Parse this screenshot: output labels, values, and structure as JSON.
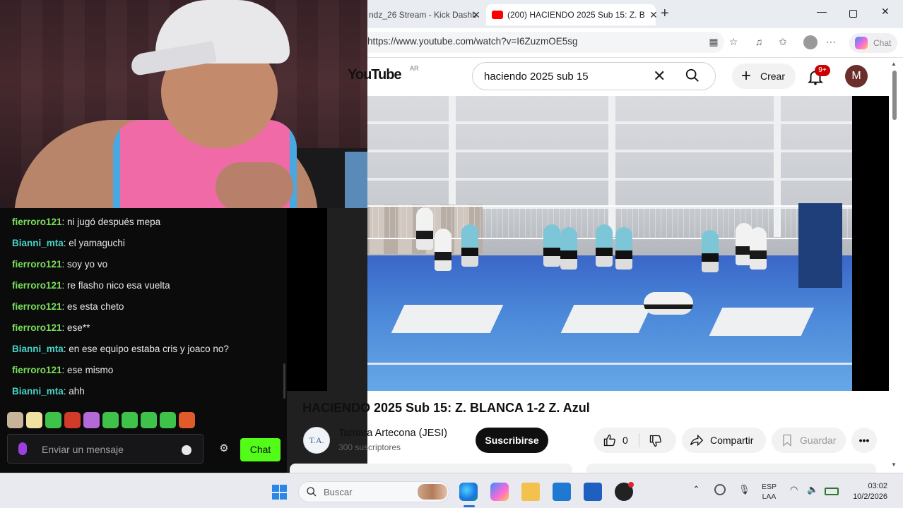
{
  "chat": {
    "messages": [
      {
        "user": "fierroro121",
        "text": ": ni jugó después mepa",
        "color": "#7be05a"
      },
      {
        "user": "Bianni_mta",
        "text": ": el yamaguchi",
        "color": "#47d4c8"
      },
      {
        "user": "fierroro121",
        "text": ": soy yo vo",
        "color": "#7be05a"
      },
      {
        "user": "fierroro121",
        "text": ": re flasho nico esa vuelta",
        "color": "#7be05a"
      },
      {
        "user": "fierroro121",
        "text": ": es esta cheto",
        "color": "#7be05a"
      },
      {
        "user": "fierroro121",
        "text": ": ese**",
        "color": "#7be05a"
      },
      {
        "user": "Bianni_mta",
        "text": ": en ese equipo estaba cris y joaco no?",
        "color": "#47d4c8"
      },
      {
        "user": "fierroro121",
        "text": ": ese mismo",
        "color": "#7be05a"
      },
      {
        "user": "Bianni_mta",
        "text": ": ahh",
        "color": "#47d4c8"
      }
    ],
    "input_placeholder": "Enviar un mensaje",
    "send_label": "Chat",
    "emotes": [
      "emote-1",
      "emote-2",
      "emote-3",
      "emote-4",
      "emote-5",
      "emote-6",
      "emote-7",
      "emote-8",
      "emote-9",
      "emote-10"
    ]
  },
  "browser": {
    "tabs": [
      {
        "title": "ndz_26 Stream - Kick Dashb"
      },
      {
        "title": "(200) HACIENDO 2025 Sub 15: Z. B"
      }
    ],
    "url": "https://www.youtube.com/watch?v=I6ZuzmOE5sg",
    "copilot_label": "Chat"
  },
  "youtube": {
    "logo": "YouTube",
    "country": "AR",
    "search_query": "haciendo 2025 sub 15",
    "create_label": "Crear",
    "notifications": "9+",
    "avatar_letter": "M",
    "video_title": "HACIENDO 2025 Sub 15: Z. BLANCA 1-2 Z. Azul",
    "channel_initials": "T.A.",
    "channel_name": "Tamara Artecona (JESI)",
    "subscribers": "300 suscriptores",
    "subscribe_label": "Suscribirse",
    "likes": "0",
    "share_label": "Compartir",
    "save_label": "Guardar"
  },
  "taskbar": {
    "search_label": "Buscar",
    "lang_line1": "ESP",
    "lang_line2": "LAA",
    "time": "03:02",
    "date": "10/2/2026"
  }
}
